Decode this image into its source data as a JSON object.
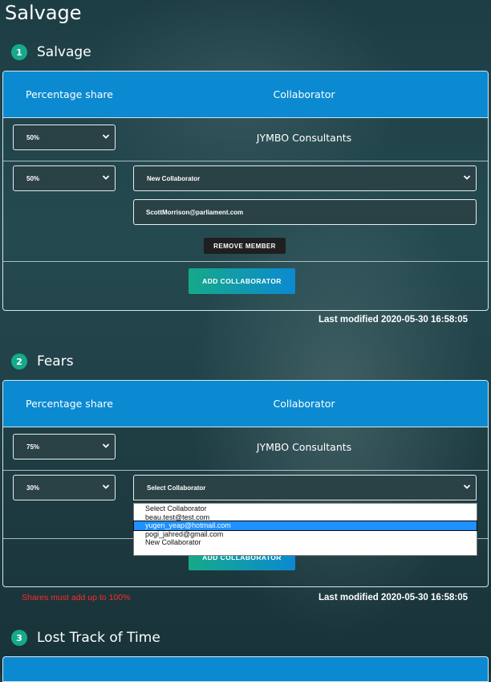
{
  "page": {
    "title": "Salvage"
  },
  "headers": {
    "percentage": "Percentage share",
    "collaborator": "Collaborator"
  },
  "sections": [
    {
      "number": "1",
      "title": "Salvage",
      "rows": [
        {
          "share": "50%",
          "collaborator_name": "JYMBO Consultants"
        },
        {
          "share": "50%",
          "collaborator_select": "New Collaborator",
          "email": "ScottMorrison@parliament.com"
        }
      ],
      "remove_label": "REMOVE MEMBER",
      "add_label": "ADD COLLABORATOR",
      "last_modified": "Last modified 2020-05-30 16:58:05"
    },
    {
      "number": "2",
      "title": "Fears",
      "rows": [
        {
          "share": "75%",
          "collaborator_name": "JYMBO Consultants"
        },
        {
          "share": "30%",
          "collaborator_select": "Select Collaborator"
        }
      ],
      "add_label": "ADD COLLABORATOR",
      "error": "Shares must add up to 100%",
      "last_modified": "Last modified 2020-05-30 16:58:05",
      "dropdown_options": [
        "Select Collaborator",
        "beau.test@test.com",
        "yugen_yeap@hotmail.com",
        "pogi_jahred@gmail.com",
        "New Collaborator"
      ],
      "dropdown_highlighted": "yugen_yeap@hotmail.com"
    },
    {
      "number": "3",
      "title": "Lost Track of Time"
    }
  ],
  "colors": {
    "header": "#0b8ad1",
    "accent": "#16a98a",
    "error": "#ff2a2a"
  }
}
